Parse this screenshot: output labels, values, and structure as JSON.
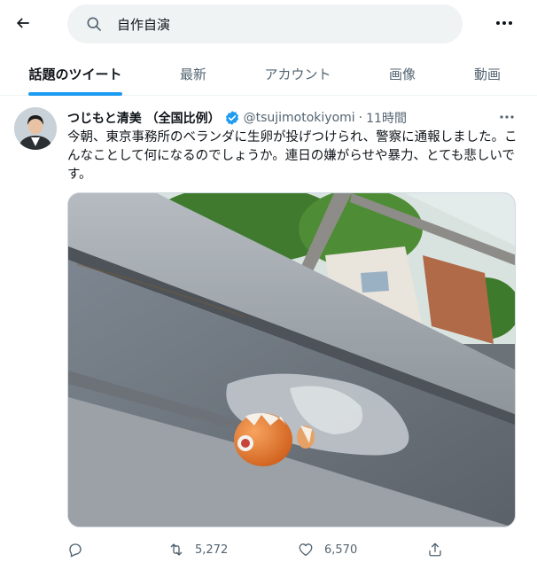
{
  "search": {
    "query": "自作自演"
  },
  "tabs": [
    {
      "label": "話題のツイート",
      "active": true
    },
    {
      "label": "最新",
      "active": false
    },
    {
      "label": "アカウント",
      "active": false
    },
    {
      "label": "画像",
      "active": false
    },
    {
      "label": "動画",
      "active": false
    }
  ],
  "tweet": {
    "display_name": "つじもと清美 （全国比例）",
    "handle": "@tsujimotokiyomi",
    "separator": "·",
    "time": "11時間",
    "text": "今朝、東京事務所のベランダに生卵が投げつけられ、警察に通報しました。こんなことして何になるのでしょうか。連日の嫌がらせや暴力、とても悲しいです。",
    "retweets": "5,272",
    "likes": "6,570"
  },
  "colors": {
    "accent": "#1d9bf0",
    "muted": "#536471",
    "text": "#0f1419",
    "search_bg": "#eff3f4"
  },
  "icons": [
    "back-arrow-icon",
    "search-icon",
    "more-icon",
    "verified-icon",
    "reply-icon",
    "retweet-icon",
    "like-icon",
    "share-icon"
  ]
}
